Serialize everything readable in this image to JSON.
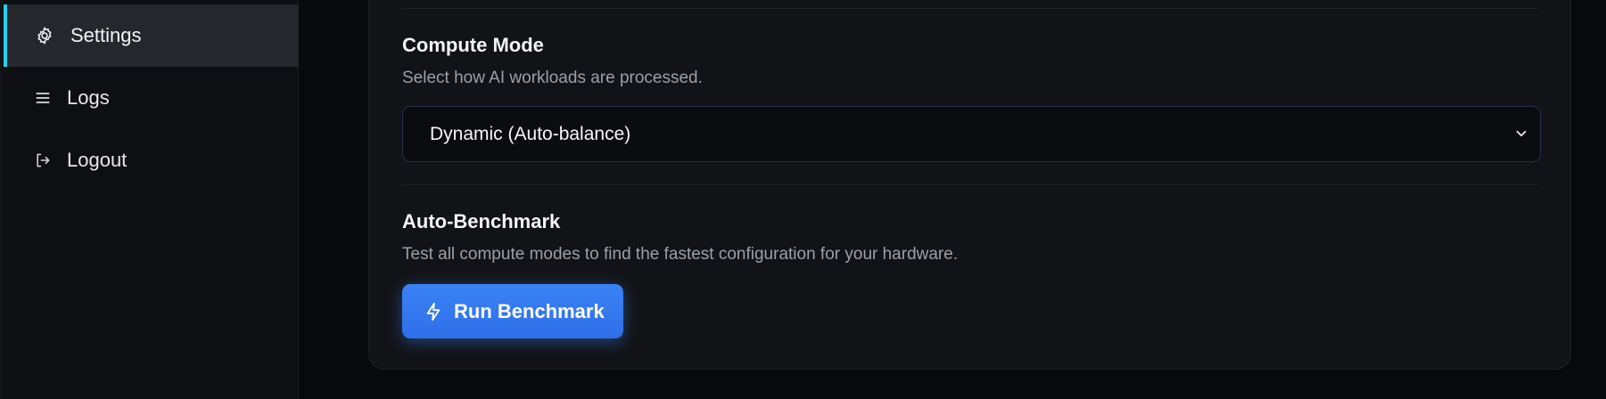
{
  "sidebar": {
    "items": [
      {
        "label": "Settings",
        "icon": "gear-icon",
        "active": true
      },
      {
        "label": "Logs",
        "icon": "list-icon",
        "active": false
      },
      {
        "label": "Logout",
        "icon": "logout-icon",
        "active": false
      }
    ]
  },
  "compute_mode": {
    "title": "Compute Mode",
    "description": "Select how AI workloads are processed.",
    "selected": "Dynamic (Auto-balance)"
  },
  "auto_benchmark": {
    "title": "Auto-Benchmark",
    "description": "Test all compute modes to find the fastest configuration for your hardware.",
    "button_label": "Run Benchmark",
    "button_icon": "lightning-icon"
  },
  "colors": {
    "accent": "#22d3ee",
    "primary_button": "#3b82f6",
    "background": "#0a0b0e",
    "card": "#121317"
  }
}
